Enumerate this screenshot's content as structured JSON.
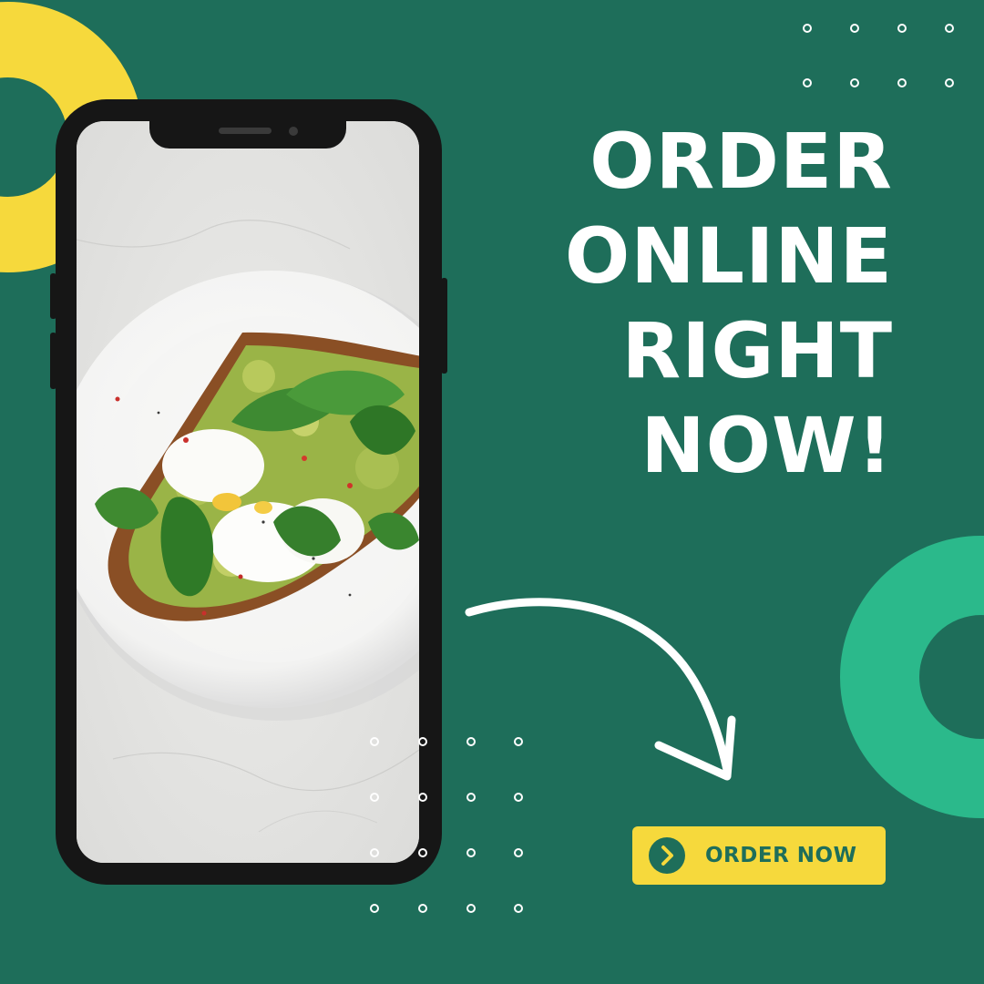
{
  "headline": {
    "lines": [
      "ORDER",
      "ONLINE",
      "RIGHT",
      "NOW!"
    ]
  },
  "cta": {
    "label": "ORDER NOW",
    "icon": "chevron-right-icon"
  },
  "colors": {
    "background": "#1e6e5a",
    "accent_yellow": "#f6d93c",
    "accent_green": "#2bb98b",
    "text": "#ffffff",
    "phone_frame": "#161616"
  },
  "image": {
    "subject": "avocado-toast-with-poached-egg-and-spinach"
  }
}
